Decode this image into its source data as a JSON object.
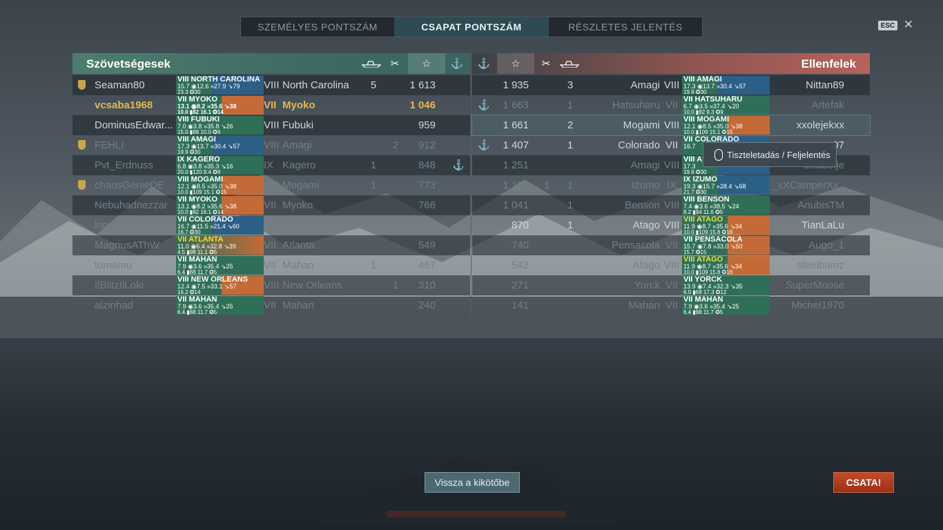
{
  "tabs": [
    "SZEMÉLYES PONTSZÁM",
    "CSAPAT PONTSZÁM",
    "RÉSZLETES JELENTÉS"
  ],
  "esc_label": "ESC",
  "close_icon": "close-icon",
  "allies": {
    "title": "Szövetségesek",
    "rows": [
      {
        "medal": true,
        "player": "Seaman80",
        "ship_card": {
          "name": "VIII NORTH CAROLINA",
          "l2": "15.7 ◉12.6 »27.9 ↘79",
          "l3": "23.3 ✪30"
        },
        "tier": "VIII",
        "ship": "North Carolina",
        "kills": "5",
        "planes": "",
        "xp": "1 613",
        "base": ""
      },
      {
        "medal": false,
        "player": "vcsaba1968",
        "ship_card": {
          "name": "VII MYOKO",
          "l2": "13.1 ◉8.2 »35.6 ↘38",
          "l3": "10.0 ▮82   16.1 ✪14"
        },
        "tier": "VII",
        "ship": "Myoko",
        "kills": "",
        "planes": "",
        "xp": "1 046",
        "base": ""
      },
      {
        "medal": false,
        "player": "DominusEdwar...",
        "ship_card": {
          "name": "VIII FUBUKI",
          "l2": "7.0 ◉3.8 »35.8 ↘26",
          "l3": "15.0 ▮88   10.0 ✪9"
        },
        "tier": "VIII",
        "ship": "Fubuki",
        "kills": "",
        "planes": "",
        "xp": "959",
        "base": ""
      },
      {
        "medal": true,
        "player": "FEHLI",
        "ship_card": {
          "name": "VIII AMAGI",
          "l2": "17.3 ◉13.7 »30.4 ↘57",
          "l3": "19.9 ✪30"
        },
        "tier": "VIII",
        "ship": "Amagi",
        "kills": "",
        "planes": "2",
        "xp": "912",
        "base": ""
      },
      {
        "medal": false,
        "player": "Pvt_Erdnuss",
        "ship_card": {
          "name": "IX KAGERO",
          "l2": "6.8 ◉3.8 »35.3 ↘16",
          "l3": "20.0 ▮120   9.4 ✪9"
        },
        "tier": "IX",
        "ship": "Kagero",
        "kills": "1",
        "planes": "",
        "xp": "848",
        "base": "⚓"
      },
      {
        "medal": true,
        "player": "chaosGenieDE",
        "ship_card": {
          "name": "VIII MOGAMI",
          "l2": "12.1 ◉8.5 »35.0 ↘38",
          "l3": "10.0 ▮109   15.1 ✪15"
        },
        "tier": "VIII",
        "ship": "Mogami",
        "kills": "1",
        "planes": "",
        "xp": "773",
        "base": ""
      },
      {
        "medal": false,
        "player": "Nebuhadnezzar",
        "ship_card": {
          "name": "VII MYOKO",
          "l2": "13.1 ◉8.2 »35.6 ↘38",
          "l3": "10.0 ▮82   16.1 ✪14"
        },
        "tier": "VII",
        "ship": "Myoko",
        "kills": "",
        "planes": "",
        "xp": "766",
        "base": ""
      },
      {
        "medal": false,
        "player": "longbow11",
        "ship_card": {
          "name": "VII COLORADO",
          "l2": "16.7 ◉11.5 »21.4 ↘60",
          "l3": "16.7 ✪30"
        },
        "tier": "VII",
        "ship": "Colorado",
        "kills": "",
        "planes": "",
        "xp": "685",
        "base": ""
      },
      {
        "medal": false,
        "player": "MagnusAThW",
        "ship_card": {
          "name": "VII ATLANTA",
          "l2": "11.0 ◉6.4 »32.8 ↘39",
          "l3": "4.5 ▮98   11.1 ✪5"
        },
        "tier": "VII",
        "ship": "Atlanta",
        "kills": "",
        "planes": "",
        "xp": "549",
        "base": ""
      },
      {
        "medal": false,
        "player": "tomamu",
        "ship_card": {
          "name": "VII MAHAN",
          "l2": "7.9 ◉3.6 »35.4 ↘25",
          "l3": "6.4 ▮88   11.7 ✪5"
        },
        "tier": "VII",
        "ship": "Mahan",
        "kills": "1",
        "planes": "",
        "xp": "467",
        "base": ""
      },
      {
        "medal": false,
        "player": "IlBlitzIlLoki",
        "ship_card": {
          "name": "VIII NEW ORLEANS",
          "l2": "12.4 ◉7.5 »33.1 ↘57",
          "l3": "16.2 ✪14"
        },
        "tier": "VIII",
        "ship": "New Orleans",
        "kills": "",
        "planes": "1",
        "xp": "310",
        "base": ""
      },
      {
        "medal": false,
        "player": "alzinhad",
        "ship_card": {
          "name": "VII MAHAN",
          "l2": "7.9 ◉3.6 »35.4 ↘25",
          "l3": "6.4 ▮88   11.7 ✪5"
        },
        "tier": "VII",
        "ship": "Mahan",
        "kills": "",
        "planes": "",
        "xp": "240",
        "base": ""
      }
    ]
  },
  "enemies": {
    "title": "Ellenfelek",
    "rows": [
      {
        "base": "",
        "xp": "1 935",
        "planes": "",
        "kills": "3",
        "ship": "Amagi",
        "tier": "VIII",
        "ship_card": {
          "name": "VIII AMAGI",
          "l2": "17.3 ◉13.7 »30.4 ↘57",
          "l3": "19.9 ✪30"
        },
        "player": "Nittan89"
      },
      {
        "base": "⚓",
        "xp": "1 663",
        "planes": "",
        "kills": "1",
        "ship": "Hatsuharu",
        "tier": "VII",
        "ship_card": {
          "name": "VII HATSUHARU",
          "l2": "6.7 ◉3.5 »37.4 ↘20",
          "l3": "10.0 ▮82   9.3 ✪9"
        },
        "player": "Artefak"
      },
      {
        "base": "",
        "xp": "1 661",
        "planes": "",
        "kills": "2",
        "ship": "Mogami",
        "tier": "VIII",
        "ship_card": {
          "name": "VIII MOGAMI",
          "l2": "12.1 ◉8.5 »35.0 ↘38",
          "l3": "10.0 ▮109   15.1 ✪15"
        },
        "player": "xxolejekxx"
      },
      {
        "base": "⚓",
        "xp": "1 407",
        "planes": "",
        "kills": "1",
        "ship": "Colorado",
        "tier": "VII",
        "ship_card": {
          "name": "VII COLORADO",
          "l2": "16.7",
          "l3": ""
        },
        "player": "07"
      },
      {
        "base": "",
        "xp": "1 251",
        "planes": "",
        "kills": "",
        "ship": "Amagi",
        "tier": "VIII",
        "ship_card": {
          "name": "VIII A",
          "l2": "17.3",
          "l3": "19.9 ✪30"
        },
        "player": "Skabofje"
      },
      {
        "base": "",
        "xp": "1 193",
        "planes": "1",
        "kills": "1",
        "ship": "Izumo",
        "tier": "IX",
        "ship_card": {
          "name": "IX IZUMO",
          "l2": "19.3 ◉15.7 »28.4 ↘68",
          "l3": "21.7 ✪30"
        },
        "player": "_xXCamperXx_"
      },
      {
        "base": "",
        "xp": "1 041",
        "planes": "",
        "kills": "1",
        "ship": "Benson",
        "tier": "VIII",
        "ship_card": {
          "name": "VIII BENSON",
          "l2": "7.4 ◉3.6 »38.5 ↘24",
          "l3": "8.2 ▮94   11.6 ✪5"
        },
        "player": "AnubisTM"
      },
      {
        "base": "",
        "xp": "870",
        "planes": "",
        "kills": "1",
        "ship": "Atago",
        "tier": "VIII",
        "ship_card": {
          "name": "VIII ATAGO",
          "l2": "11.9 ◉8.7 »35.6 ↘34",
          "l3": "10.0 ▮109   15.8 ✪16"
        },
        "player": "TianLaLu"
      },
      {
        "base": "",
        "xp": "740",
        "planes": "",
        "kills": "",
        "ship": "Pensacola",
        "tier": "VII",
        "ship_card": {
          "name": "VII PENSACOLA",
          "l2": "15.7 ◉7.8 »33.0 ↘50",
          "l3": "15.7 ✪15"
        },
        "player": "Augo_1"
      },
      {
        "base": "",
        "xp": "542",
        "planes": "",
        "kills": "",
        "ship": "Atago",
        "tier": "VIII",
        "ship_card": {
          "name": "VIII ATAGO",
          "l2": "11.9 ◉8.7 »35.6 ↘34",
          "l3": "10.0 ▮109   15.8 ✪16"
        },
        "player": "steelbamz"
      },
      {
        "base": "",
        "xp": "271",
        "planes": "",
        "kills": "",
        "ship": "Yorck",
        "tier": "VII",
        "ship_card": {
          "name": "VII YORCK",
          "l2": "13.9 ◉7.4 »32.3 ↘35",
          "l3": "6.0 ▮68   17.3 ✪12"
        },
        "player": "SuperMoose"
      },
      {
        "base": "",
        "xp": "141",
        "planes": "",
        "kills": "",
        "ship": "Mahan",
        "tier": "VII",
        "ship_card": {
          "name": "VII MAHAN",
          "l2": "7.9 ◉3.6 »35.4 ↘25",
          "l3": "6.4 ▮88   11.7 ✪5"
        },
        "player": "Michel1970"
      }
    ]
  },
  "tooltip": "Tiszteletadás / Feljelentés",
  "back_button": "Vissza a kikötőbe",
  "battle_button": "CSATA!"
}
